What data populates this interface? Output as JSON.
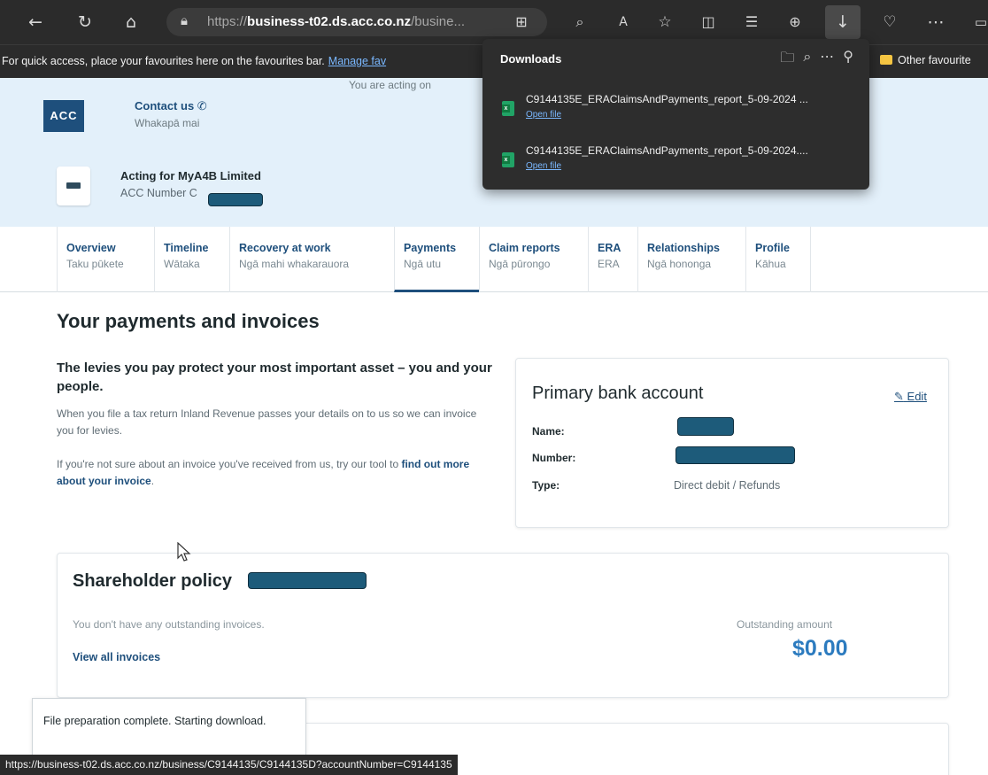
{
  "browser": {
    "url_prefix": "https://",
    "url_domain": "business-t02.ds.acc.co.nz",
    "url_rest": "/busine...",
    "favourites_bar": {
      "message": "For quick access, place your favourites here on the favourites bar.",
      "manage_link": "Manage fav",
      "other_favourites": "Other favourite"
    },
    "toolbar_icons": [
      "back-icon",
      "refresh-icon",
      "home-icon",
      "lock-icon",
      "apps-icon",
      "zoom-icon",
      "read-aloud-icon",
      "favourite-icon",
      "split-screen-icon",
      "favourites-list-icon",
      "collections-icon",
      "download-icon",
      "browser-essentials-icon",
      "more-icon"
    ]
  },
  "downloads": {
    "title": "Downloads",
    "items": [
      {
        "filename": "C9144135E_ERAClaimsAndPayments_report_5-09-2024 ...",
        "open_label": "Open file"
      },
      {
        "filename": "C9144135E_ERAClaimsAndPayments_report_5-09-2024....",
        "open_label": "Open file"
      }
    ]
  },
  "header": {
    "acting_notice": "You are acting on",
    "logo": "ACC",
    "contact_label": "Contact us",
    "contact_sub": "Whakapā mai",
    "acting_for": "Acting for MyA4B Limited",
    "acc_number_label": "ACC Number C"
  },
  "tabs": [
    {
      "en": "Overview",
      "mi": "Taku pūkete"
    },
    {
      "en": "Timeline",
      "mi": "Wātaka"
    },
    {
      "en": "Recovery at work",
      "mi": "Ngā mahi whakarauora"
    },
    {
      "en": "Payments",
      "mi": "Ngā utu",
      "active": true
    },
    {
      "en": "Claim reports",
      "mi": "Ngā pūrongo"
    },
    {
      "en": "ERA",
      "mi": "ERA"
    },
    {
      "en": "Relationships",
      "mi": "Ngā hononga"
    },
    {
      "en": "Profile",
      "mi": "Kāhua"
    }
  ],
  "main": {
    "title": "Your payments and invoices",
    "intro_title": "The levies you pay protect your most important asset – you and your people.",
    "intro_p1": "When you file a tax return Inland Revenue passes your details on to us so we can invoice you for levies.",
    "intro_p2_before": "If you're not sure about an invoice you've received from us, try our tool to ",
    "intro_p2_link": "find out more about your invoice",
    "intro_p2_after": "."
  },
  "bank": {
    "title": "Primary bank account",
    "edit": "Edit",
    "name_label": "Name:",
    "number_label": "Number:",
    "type_label": "Type:",
    "type_value": "Direct debit / Refunds"
  },
  "policy": {
    "title": "Shareholder policy",
    "no_invoices": "You don't have any outstanding invoices.",
    "view_all": "View all invoices",
    "outstanding_label": "Outstanding amount",
    "outstanding_amount": "$0.00"
  },
  "toast": {
    "message": "File preparation complete. Starting download."
  },
  "statusbar": {
    "url": "https://business-t02.ds.acc.co.nz/business/C9144135/C9144135D?accountNumber=C9144135"
  },
  "colors": {
    "brand": "#1e4f7c",
    "header_bg": "#e3f0fa",
    "amount": "#2c7bbf",
    "redaction": "#1d5b7a"
  }
}
